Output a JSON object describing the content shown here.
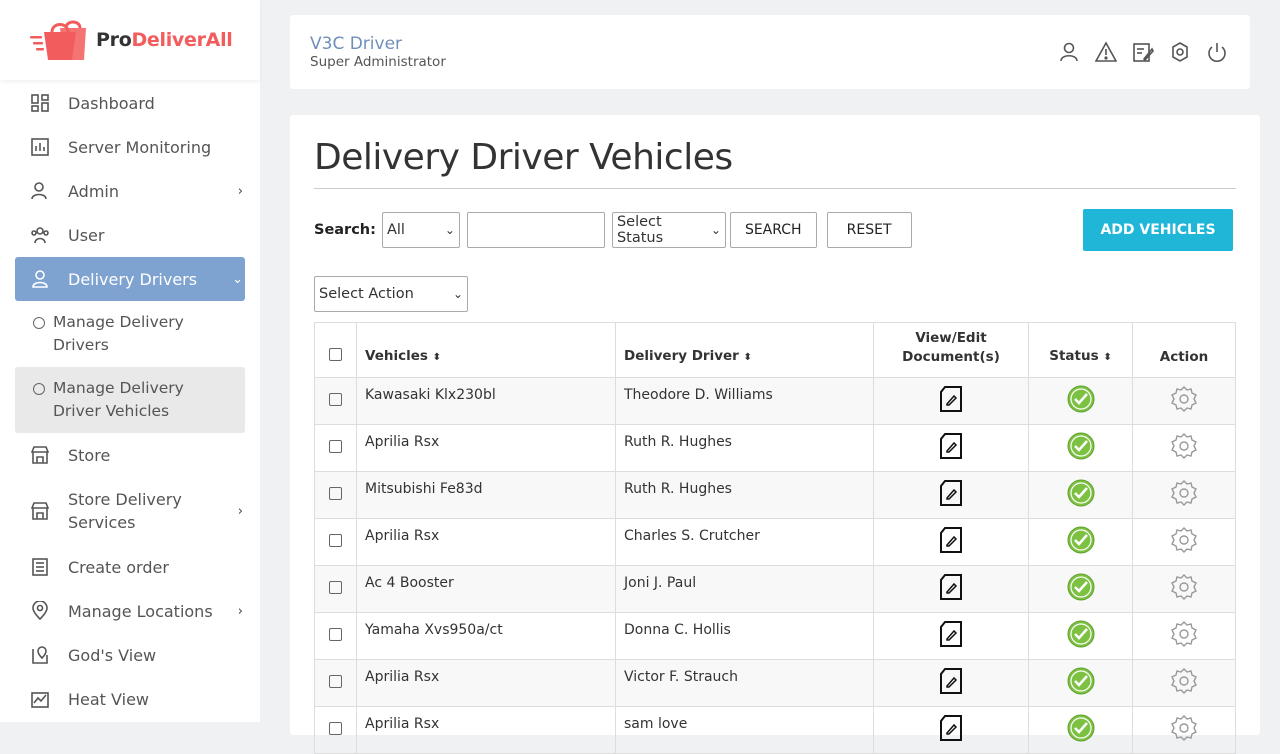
{
  "brand": {
    "pro": "Pro",
    "rest": "DeliverAll"
  },
  "header": {
    "user_name": "V3C Driver",
    "user_role": "Super Administrator"
  },
  "sidebar": {
    "items": [
      {
        "label": "Dashboard"
      },
      {
        "label": "Server Monitoring"
      },
      {
        "label": "Admin"
      },
      {
        "label": "User"
      },
      {
        "label": "Delivery Drivers"
      },
      {
        "label": "Manage Delivery Drivers"
      },
      {
        "label": "Manage Delivery Driver Vehicles"
      },
      {
        "label": "Store"
      },
      {
        "label": "Store Delivery Services"
      },
      {
        "label": "Create order"
      },
      {
        "label": "Manage Locations"
      },
      {
        "label": "God's View"
      },
      {
        "label": "Heat View"
      }
    ]
  },
  "page": {
    "title": "Delivery Driver Vehicles"
  },
  "search": {
    "label": "Search:",
    "type_value": "All",
    "status_value": "Select Status",
    "search_button": "SEARCH",
    "reset_button": "RESET",
    "add_button": "ADD VEHICLES",
    "action_value": "Select Action"
  },
  "table": {
    "headers": {
      "vehicles": "Vehicles",
      "driver": "Delivery Driver",
      "docs": "View/Edit Document(s)",
      "status": "Status",
      "action": "Action"
    },
    "rows": [
      {
        "vehicle": "Kawasaki Klx230bl",
        "driver": "Theodore D. Williams"
      },
      {
        "vehicle": "Aprilia Rsx",
        "driver": "Ruth R. Hughes"
      },
      {
        "vehicle": "Mitsubishi Fe83d",
        "driver": "Ruth R. Hughes"
      },
      {
        "vehicle": "Aprilia Rsx",
        "driver": "Charles S. Crutcher"
      },
      {
        "vehicle": "Ac 4 Booster",
        "driver": "Joni J. Paul"
      },
      {
        "vehicle": "Yamaha Xvs950a/ct",
        "driver": "Donna C. Hollis"
      },
      {
        "vehicle": "Aprilia Rsx",
        "driver": "Victor F. Strauch"
      },
      {
        "vehicle": "Aprilia Rsx",
        "driver": "sam love"
      }
    ]
  },
  "colors": {
    "accent": "#1fb6d8",
    "active_nav": "#7fa3d0",
    "brand": "#f25c5c",
    "status_ok": "#7dc142"
  }
}
